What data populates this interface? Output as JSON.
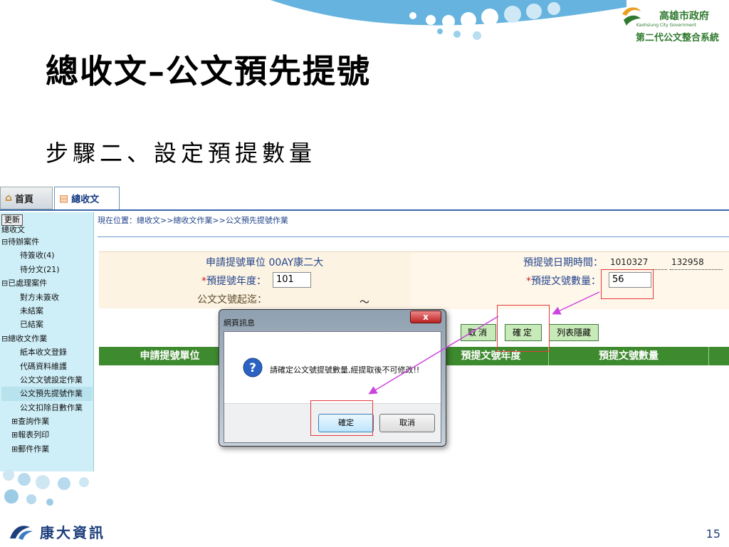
{
  "slide": {
    "title": "總收文–公文預先提號",
    "subtitle": "步驟二、設定預提數量",
    "page_number": "15"
  },
  "branding": {
    "gov_name": "高雄市政府",
    "gov_name_en": "Kaohsiung City Government",
    "system_name": "第二代公文整合系統",
    "company": "康大資訊"
  },
  "tabs": [
    {
      "label": "首頁",
      "icon": "house-icon"
    },
    {
      "label": "總收文",
      "icon": "inbox-tray-icon",
      "active": true
    }
  ],
  "sidebar": {
    "refresh_label": "更新",
    "root_label": "總收文",
    "items": [
      {
        "label": "待辦案件",
        "toggle": "⊟",
        "level": 0
      },
      {
        "label": "待簽收(4)",
        "level": 1
      },
      {
        "label": "待分文(21)",
        "level": 1
      },
      {
        "label": "已處理案件",
        "toggle": "⊟",
        "level": 0
      },
      {
        "label": "對方未簽收",
        "level": 1
      },
      {
        "label": "未結案",
        "level": 1
      },
      {
        "label": "已結案",
        "level": 1
      },
      {
        "label": "總收文作業",
        "toggle": "⊟",
        "level": 0
      },
      {
        "label": "紙本收文登錄",
        "level": 1
      },
      {
        "label": "代碼資料維護",
        "level": 1
      },
      {
        "label": "公文文號設定作業",
        "level": 1
      },
      {
        "label": "公文預先提號作業",
        "level": 1,
        "selected": true
      },
      {
        "label": "公文扣除日數作業",
        "level": 1
      },
      {
        "label": "查詢作業",
        "toggle": "⊞",
        "level": 1
      },
      {
        "label": "報表列印",
        "toggle": "⊞",
        "level": 1
      },
      {
        "label": "郵件作業",
        "toggle": "⊞",
        "level": 1
      }
    ]
  },
  "content": {
    "breadcrumb": "現在位置：總收文>>總收文作業>>公文預先提號作業",
    "form": {
      "unit_label": "申請提號單位",
      "unit_value": "00AY康二大",
      "year_required": "*",
      "year_label": "預提號年度：",
      "year_value": "101",
      "range_label": "公文文號起迄：",
      "range_sep": "～",
      "datetime_label": "預提號日期時間：",
      "date_value": "1010327",
      "time_value": "132958",
      "count_required": "*",
      "count_label": "預提文號數量：",
      "count_value": "56"
    },
    "buttons": {
      "cancel": "取消",
      "confirm": "確定",
      "hide_list": "列表隱藏"
    },
    "grid_headers": [
      "申請提號單位",
      "預提文號年度",
      "預提文號數量"
    ]
  },
  "dialog": {
    "title": "網頁訊息",
    "close_glyph": "x",
    "message": "請確定公文號提號數量,經提取後不可修改!!",
    "ok_label": "確定",
    "cancel_label": "取消"
  },
  "colors": {
    "annotation_red": "#e23a3a",
    "annotation_arrow": "#cc44dd",
    "grid_header_green": "#3e8a2e",
    "sidebar_bg": "#cfeff8"
  }
}
